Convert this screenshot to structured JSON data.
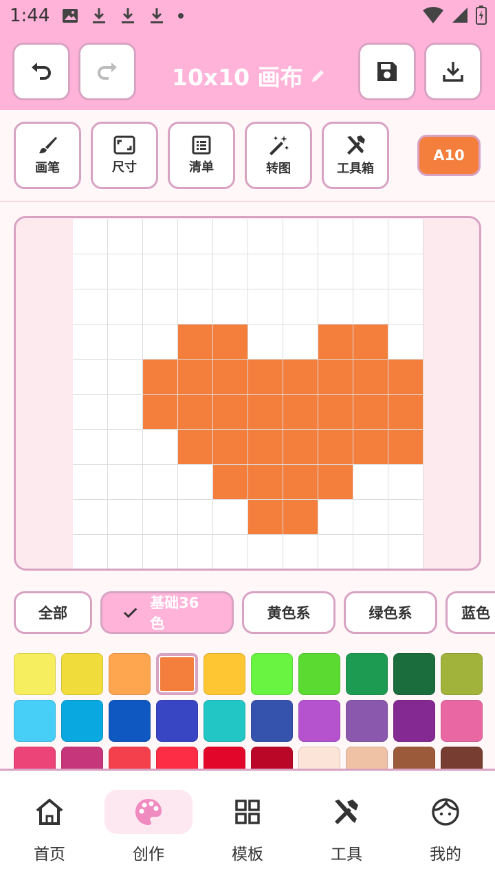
{
  "status_bar": {
    "time": "1:44"
  },
  "header": {
    "title": "10x10 画布",
    "undo_label": "undo",
    "redo_label": "redo",
    "save_label": "save",
    "download_label": "download"
  },
  "toolbar": {
    "tools": [
      {
        "label": "画笔",
        "icon": "brush-icon"
      },
      {
        "label": "尺寸",
        "icon": "resize-icon"
      },
      {
        "label": "清单",
        "icon": "list-icon"
      },
      {
        "label": "转图",
        "icon": "magic-wand-icon"
      },
      {
        "label": "工具箱",
        "icon": "toolbox-icon"
      }
    ],
    "current_color_code": "A10",
    "current_color": "#f47e3b"
  },
  "canvas": {
    "size": "10x10",
    "fill_color": "#f47e3b",
    "rows": [
      "0000000000",
      "0000000000",
      "0000000000",
      "0001100110",
      "0011111111",
      "0011111111",
      "0001111111",
      "0000111100",
      "0000011000",
      "0000000000"
    ]
  },
  "palette_tabs": {
    "items": [
      "全部",
      "基础36色",
      "黄色系",
      "绿色系",
      "蓝色"
    ],
    "selected": "基础36色"
  },
  "palette": {
    "selected_index": 3,
    "colors": [
      "#f7ee5f",
      "#f0dc3a",
      "#fda54f",
      "#f47e3b",
      "#fec632",
      "#69f442",
      "#5bdb32",
      "#1e9b52",
      "#1b6d3e",
      "#a1b33b",
      "#48cff7",
      "#0aa8e0",
      "#0f57c1",
      "#3846c4",
      "#22c6c4",
      "#3552ac",
      "#b553cf",
      "#8a58ad",
      "#852992",
      "#e967a3",
      "#ec4378",
      "#c6367a",
      "#f3404c",
      "#fc2d45",
      "#e2062a",
      "#bb0727",
      "#fde4d9",
      "#f0c2a5",
      "#9b5b3b",
      "#773d30"
    ]
  },
  "bottom_nav": {
    "items": [
      {
        "label": "首页",
        "icon": "home-icon"
      },
      {
        "label": "创作",
        "icon": "palette-icon"
      },
      {
        "label": "模板",
        "icon": "template-grid-icon"
      },
      {
        "label": "工具",
        "icon": "tools-icon"
      },
      {
        "label": "我的",
        "icon": "profile-icon"
      }
    ],
    "active": "创作"
  }
}
